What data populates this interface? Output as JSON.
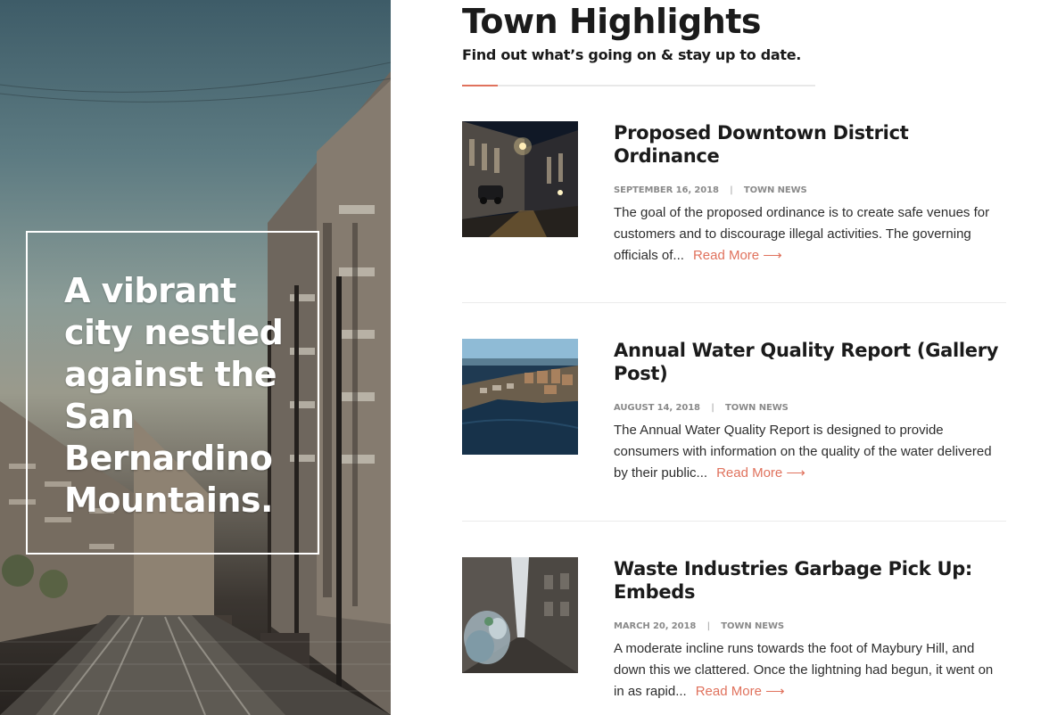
{
  "hero": {
    "tagline": "A vibrant city nestled against the San Bernardino Mountains."
  },
  "section": {
    "title": "Town Highlights",
    "subtitle": "Find out what’s going on & stay up to date."
  },
  "colors": {
    "accent": "#e0725d",
    "heading": "#1b1b1b",
    "meta": "#8a8a8a",
    "body": "#2d2d2d"
  },
  "posts": [
    {
      "title": "Proposed Downtown District Ordinance",
      "date": "SEPTEMBER 16, 2018",
      "separator": "|",
      "category": "TOWN NEWS",
      "excerpt": "The goal of the proposed ordinance is to create safe venues for customers and to discourage illegal activities. The governing officials of...",
      "read_more": "Read More ⟶",
      "thumbnail_icon": "night-street-photo"
    },
    {
      "title": "Annual Water Quality Report (Gallery Post)",
      "date": "AUGUST 14, 2018",
      "separator": "|",
      "category": "TOWN NEWS",
      "excerpt": "The Annual Water Quality Report is designed to provide consumers with information on the quality of the water delivered by their public...",
      "read_more": "Read More ⟶",
      "thumbnail_icon": "harbor-aerial-photo"
    },
    {
      "title": "Waste Industries Garbage Pick Up: Embeds",
      "date": "MARCH 20, 2018",
      "separator": "|",
      "category": "TOWN NEWS",
      "excerpt": "A moderate incline runs towards the foot of Maybury Hill, and down this we clattered. Once the lightning had begun, it went on in as rapid...",
      "read_more": "Read More ⟶",
      "thumbnail_icon": "alley-garbage-photo"
    }
  ]
}
